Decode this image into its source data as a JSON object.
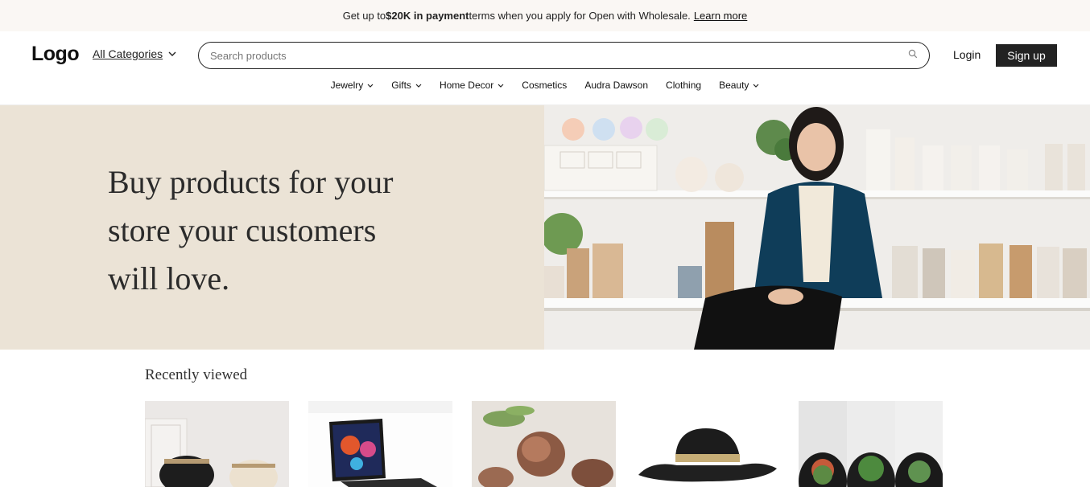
{
  "promo": {
    "prefix": "Get up to ",
    "amount": "$20K in payment",
    "suffix": " terms when you apply for Open with Wholesale.",
    "link": "Learn more"
  },
  "header": {
    "logo": "Logo",
    "all_categories": "All Categories",
    "search_placeholder": "Search products",
    "login": "Login",
    "signup": "Sign up"
  },
  "nav": {
    "items": [
      {
        "label": "Jewelry",
        "dropdown": true
      },
      {
        "label": "Gifts",
        "dropdown": true
      },
      {
        "label": "Home Decor",
        "dropdown": true
      },
      {
        "label": "Cosmetics",
        "dropdown": false
      },
      {
        "label": "Audra Dawson",
        "dropdown": false
      },
      {
        "label": "Clothing",
        "dropdown": false
      },
      {
        "label": "Beauty",
        "dropdown": true
      }
    ]
  },
  "hero": {
    "line1": "Buy products for your",
    "line2": "store your customers",
    "line3": "will love."
  },
  "recent": {
    "title": "Recently viewed",
    "items": [
      "vases",
      "laptop",
      "copper-bowls",
      "straw-hat",
      "succulent-planters"
    ]
  }
}
